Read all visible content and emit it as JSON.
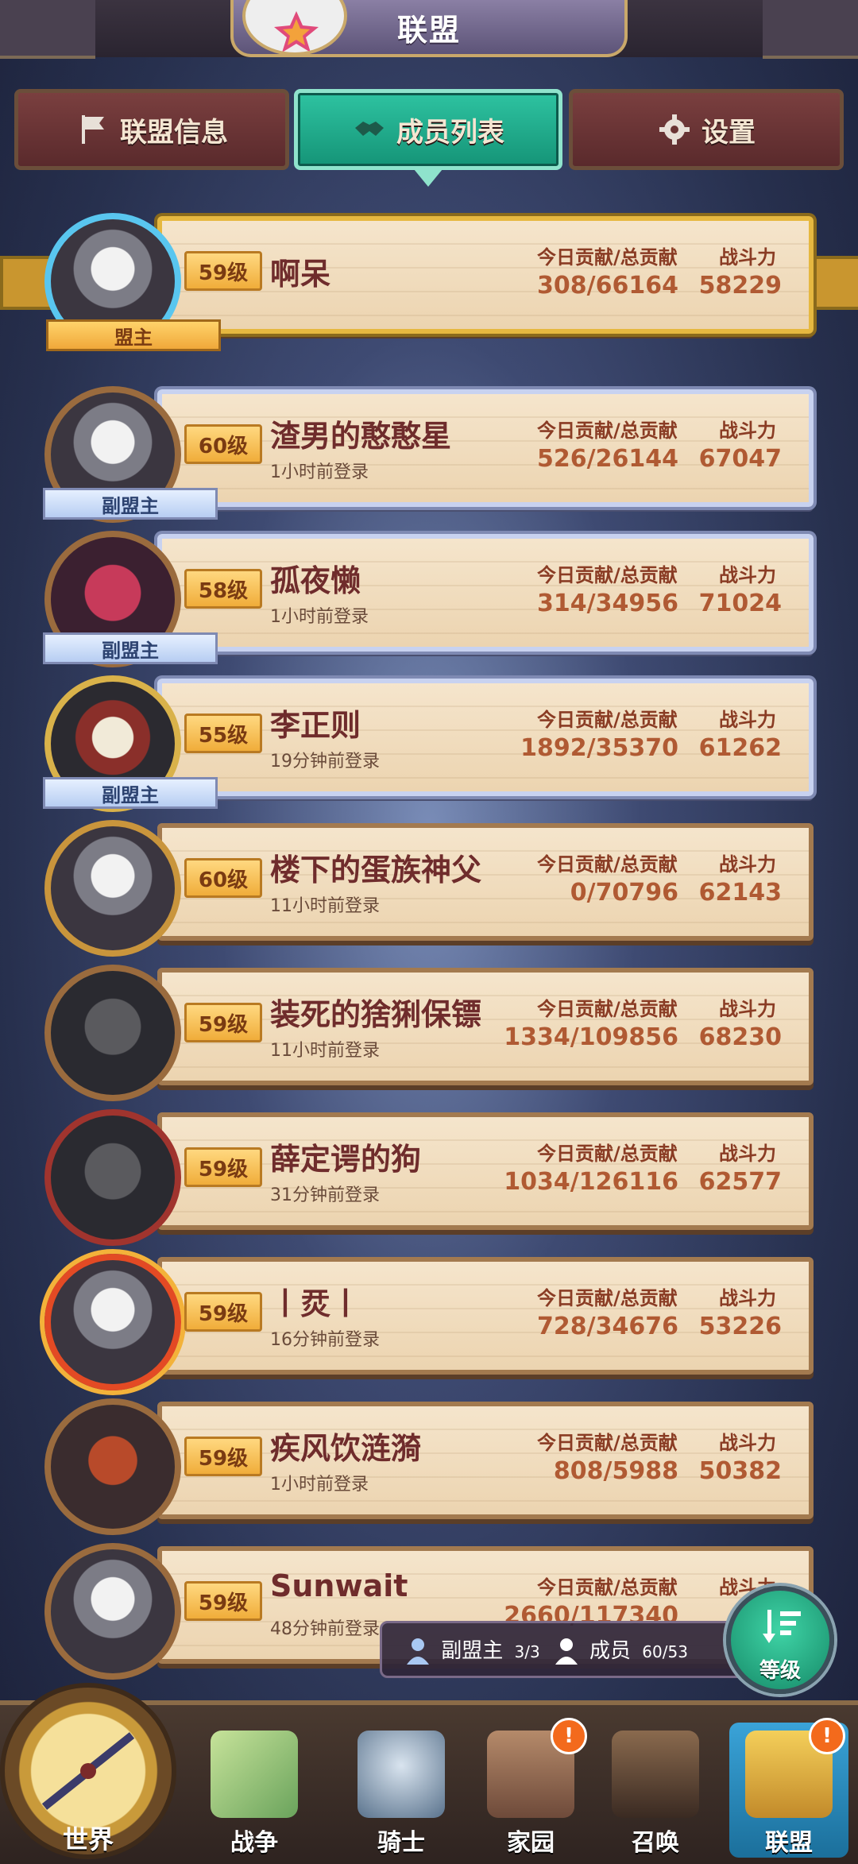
{
  "header": {
    "title": "联盟"
  },
  "tabs": [
    {
      "label": "联盟信息",
      "icon": "flag-icon",
      "active": false
    },
    {
      "label": "成员列表",
      "icon": "handshake-icon",
      "active": true
    },
    {
      "label": "设置",
      "icon": "gear-icon",
      "active": false
    }
  ],
  "labels": {
    "contrib": "今日贡献/总贡献",
    "power": "战斗力"
  },
  "members": [
    {
      "level": "59级",
      "name": "啊呆",
      "login": "",
      "contrib": "308/66164",
      "power": "58229",
      "role": "盟主",
      "style": "gold"
    },
    {
      "level": "60级",
      "name": "渣男的憨憨星",
      "login": "1小时前登录",
      "contrib": "526/26144",
      "power": "67047",
      "role": "副盟主",
      "style": "silver"
    },
    {
      "level": "58级",
      "name": "孤夜懒",
      "login": "1小时前登录",
      "contrib": "314/34956",
      "power": "71024",
      "role": "副盟主",
      "style": "silver"
    },
    {
      "level": "55级",
      "name": "李正则",
      "login": "19分钟前登录",
      "contrib": "1892/35370",
      "power": "61262",
      "role": "副盟主",
      "style": "silver"
    },
    {
      "level": "60级",
      "name": "楼下的蛋族神父",
      "login": "11小时前登录",
      "contrib": "0/70796",
      "power": "62143",
      "role": "",
      "style": "normal"
    },
    {
      "level": "59级",
      "name": "装死的猞猁保镖",
      "login": "11小时前登录",
      "contrib": "1334/109856",
      "power": "68230",
      "role": "",
      "style": "normal"
    },
    {
      "level": "59级",
      "name": "薛定谔的狗",
      "login": "31分钟前登录",
      "contrib": "1034/126116",
      "power": "62577",
      "role": "",
      "style": "normal"
    },
    {
      "level": "59级",
      "name": "丨烎丨",
      "login": "16分钟前登录",
      "contrib": "728/34676",
      "power": "53226",
      "role": "",
      "style": "normal"
    },
    {
      "level": "59级",
      "name": "疾风饮涟漪",
      "login": "1小时前登录",
      "contrib": "808/5988",
      "power": "50382",
      "role": "",
      "style": "normal"
    },
    {
      "level": "59级",
      "name": "Sunwait",
      "login": "48分钟前登录",
      "contrib": "2660/117340",
      "power": "",
      "role": "",
      "style": "normal"
    }
  ],
  "counts": {
    "vice_label": "副盟主",
    "vice_value": "3/3",
    "member_label": "成员",
    "member_value": "60/53"
  },
  "sort_button": {
    "label": "等级"
  },
  "bottom_nav": [
    {
      "label": "世界",
      "badge": ""
    },
    {
      "label": "战争",
      "badge": ""
    },
    {
      "label": "骑士",
      "badge": ""
    },
    {
      "label": "家园",
      "badge": "!"
    },
    {
      "label": "召唤",
      "badge": ""
    },
    {
      "label": "联盟",
      "badge": "!"
    }
  ]
}
